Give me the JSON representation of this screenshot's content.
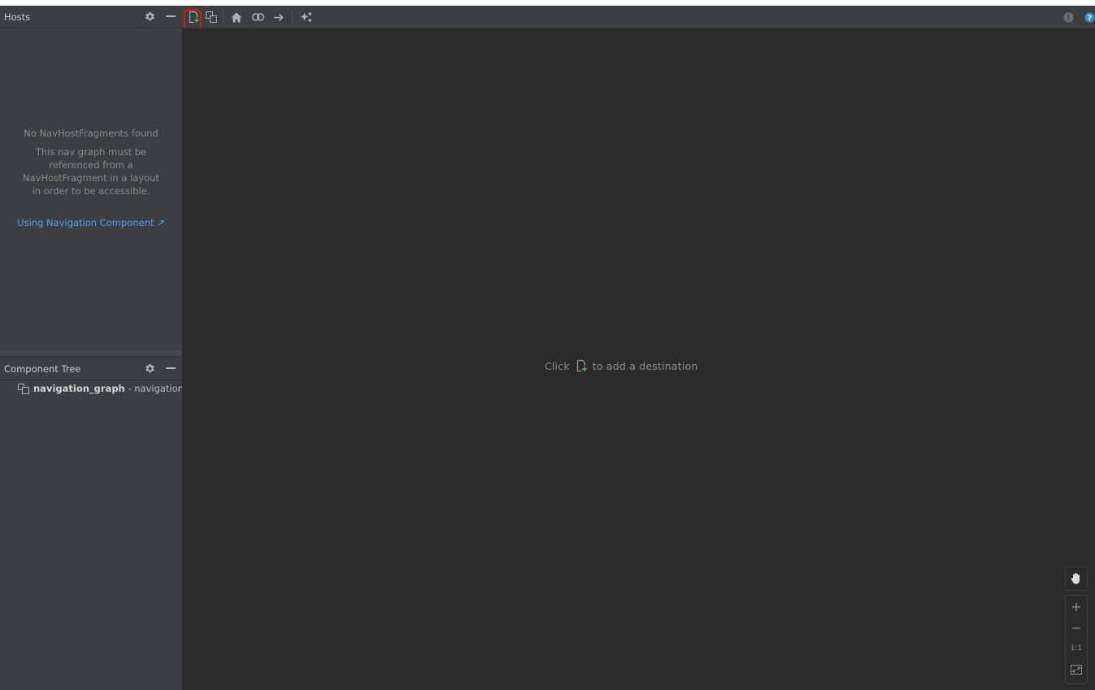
{
  "hosts_panel": {
    "title": "Hosts",
    "empty_title": "No NavHostFragments found",
    "empty_description": "This nav graph must be referenced from a NavHostFragment in a layout in order to be accessible.",
    "link_label": "Using Navigation Component ↗"
  },
  "component_tree": {
    "title": "Component Tree",
    "root_name": "navigation_graph",
    "root_suffix": " - navigation"
  },
  "canvas": {
    "hint_prefix": "Click",
    "hint_suffix": "to add a destination"
  },
  "zoom_controls": {
    "zoom_in": "+",
    "zoom_out": "−",
    "actual_size": "1:1"
  },
  "colors": {
    "highlight": "#e0131b",
    "link": "#589df6",
    "add_accent": "#59a869"
  }
}
